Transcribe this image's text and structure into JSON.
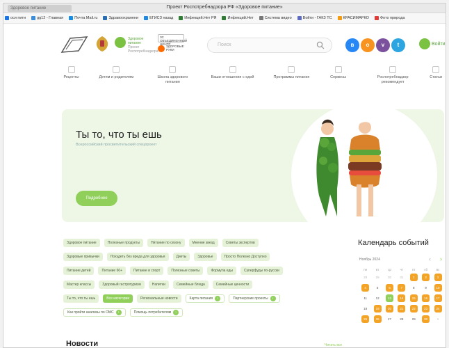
{
  "browser": {
    "tab_label": "Здоровое питание",
    "window_title": "Проект Роспотребнадзора РФ «Здоровое питание»",
    "bookmarks": [
      {
        "label": "оси пити",
        "color": "#1a73e8"
      },
      {
        "label": "gg12 - Главная",
        "color": "#3a8dde"
      },
      {
        "label": "Почта Mail.ru",
        "color": "#168de2"
      },
      {
        "label": "Здравоохранени",
        "color": "#2b6cb0"
      },
      {
        "label": "ЕГИСЗ назад",
        "color": "#1e88e5"
      },
      {
        "label": "Инфекций.Нет РЯ",
        "color": "#2e7d32"
      },
      {
        "label": "Инфекций.Нет",
        "color": "#2e7d32"
      },
      {
        "label": "Система видео",
        "color": "#777777"
      },
      {
        "label": "Войти - ГАКЗ ТС",
        "color": "#5c6bc0"
      },
      {
        "label": "КРАСИМАРКО",
        "color": "#f39c12"
      },
      {
        "label": "Фото природа",
        "color": "#e53935"
      }
    ]
  },
  "header": {
    "brand_text": "Здоровое питание",
    "brand_sub": "Проект Роспотребнадзора",
    "badge1": "ЗС ОБЪЕДИНЕННЫЙ ЦЕНТР",
    "badge2": "ЗДОРОВЫЕ РУКИ",
    "search_placeholder": "Поиск",
    "social": [
      {
        "name": "vk",
        "glyph": "в"
      },
      {
        "name": "ok",
        "glyph": "о"
      },
      {
        "name": "viber",
        "glyph": "v"
      },
      {
        "name": "telegram",
        "glyph": "t"
      }
    ],
    "login_label": "Войти"
  },
  "nav": [
    {
      "label": "Рецепты",
      "icon": "recipes-icon"
    },
    {
      "label": "Детям и родителям",
      "icon": "family-icon"
    },
    {
      "label": "Школа здорового питания",
      "icon": "school-icon"
    },
    {
      "label": "Ваши отношения с едой",
      "icon": "relations-icon"
    },
    {
      "label": "Программы питания",
      "icon": "programs-icon"
    },
    {
      "label": "Сервисы",
      "icon": "services-icon"
    },
    {
      "label": "Роспотребнадзор рекомендует",
      "icon": "recommend-icon"
    },
    {
      "label": "Статьи",
      "icon": "articles-icon"
    }
  ],
  "hero": {
    "title": "Ты то, что ты ешь",
    "subtitle": "Всероссийский просветительский спецпроект",
    "button": "Подробнее"
  },
  "tags": [
    [
      {
        "label": "Здоровое питание",
        "style": "normal"
      },
      {
        "label": "Полезные продукты",
        "style": "normal"
      },
      {
        "label": "Питание по сезону",
        "style": "normal"
      },
      {
        "label": "Мнение звезд",
        "style": "normal"
      },
      {
        "label": "Советы экспертов",
        "style": "normal"
      }
    ],
    [
      {
        "label": "Здоровые привычки",
        "style": "normal"
      },
      {
        "label": "Похудеть без вреда для здоровья",
        "style": "normal"
      },
      {
        "label": "Диеты",
        "style": "normal"
      },
      {
        "label": "Здоровье",
        "style": "normal"
      },
      {
        "label": "Просто Полезно Доступно",
        "style": "normal"
      }
    ],
    [
      {
        "label": "Питание детей",
        "style": "normal"
      },
      {
        "label": "Питание 60+",
        "style": "normal"
      },
      {
        "label": "Питание и спорт",
        "style": "normal"
      },
      {
        "label": "Полезные советы",
        "style": "normal"
      },
      {
        "label": "Формула еды",
        "style": "normal"
      },
      {
        "label": "Суперфуды по-русски",
        "style": "normal"
      }
    ],
    [
      {
        "label": "Мастер классы",
        "style": "normal"
      },
      {
        "label": "Здоровый гастротуризм",
        "style": "normal"
      },
      {
        "label": "Напитки",
        "style": "normal"
      },
      {
        "label": "Семейные блюда",
        "style": "normal"
      },
      {
        "label": "Семейные ценности",
        "style": "normal"
      }
    ],
    [
      {
        "label": "Ты то, что ты ешь",
        "style": "normal"
      },
      {
        "label": "Все категории",
        "style": "active"
      },
      {
        "label": "Региональные новости",
        "style": "normal"
      },
      {
        "label": "Карта питания",
        "style": "outline-x"
      },
      {
        "label": "Партнерские проекты",
        "style": "outline-x"
      }
    ],
    [
      {
        "label": "Как пройти анализы по ОМС",
        "style": "outline-x"
      },
      {
        "label": "Помощь потребителям",
        "style": "outline-x"
      }
    ]
  ],
  "calendar": {
    "title": "Календарь событий",
    "month": "Ноябрь 2024",
    "weekdays": [
      "пн",
      "вт",
      "ср",
      "чт",
      "пт",
      "сб",
      "вс"
    ],
    "weeks": [
      [
        {
          "d": "28",
          "s": "m"
        },
        {
          "d": "29",
          "s": "m"
        },
        {
          "d": "30",
          "s": "m"
        },
        {
          "d": "31",
          "s": "m"
        },
        {
          "d": "1",
          "s": "o"
        },
        {
          "d": "2",
          "s": "o"
        },
        {
          "d": "3",
          "s": "o"
        }
      ],
      [
        {
          "d": "4",
          "s": "o"
        },
        {
          "d": "5",
          "s": ""
        },
        {
          "d": "6",
          "s": "o"
        },
        {
          "d": "7",
          "s": "o"
        },
        {
          "d": "8",
          "s": ""
        },
        {
          "d": "9",
          "s": ""
        },
        {
          "d": "10",
          "s": "o"
        }
      ],
      [
        {
          "d": "11",
          "s": ""
        },
        {
          "d": "12",
          "s": ""
        },
        {
          "d": "13",
          "s": "g"
        },
        {
          "d": "14",
          "s": "o"
        },
        {
          "d": "15",
          "s": "o"
        },
        {
          "d": "16",
          "s": "o"
        },
        {
          "d": "17",
          "s": "o"
        }
      ],
      [
        {
          "d": "18",
          "s": ""
        },
        {
          "d": "19",
          "s": "o"
        },
        {
          "d": "20",
          "s": "o"
        },
        {
          "d": "21",
          "s": "o"
        },
        {
          "d": "22",
          "s": "o"
        },
        {
          "d": "23",
          "s": "o"
        },
        {
          "d": "24",
          "s": "o"
        }
      ],
      [
        {
          "d": "25",
          "s": "o"
        },
        {
          "d": "26",
          "s": "o"
        },
        {
          "d": "27",
          "s": ""
        },
        {
          "d": "28",
          "s": ""
        },
        {
          "d": "29",
          "s": ""
        },
        {
          "d": "30",
          "s": "o"
        },
        {
          "d": "1",
          "s": "m"
        }
      ]
    ]
  },
  "news": {
    "title": "Новости",
    "all_link": "Читать все"
  },
  "colors": {
    "accent_green": "#8fcf5a",
    "event_orange": "#f3a326",
    "hero_bg": "#eef6e6"
  }
}
